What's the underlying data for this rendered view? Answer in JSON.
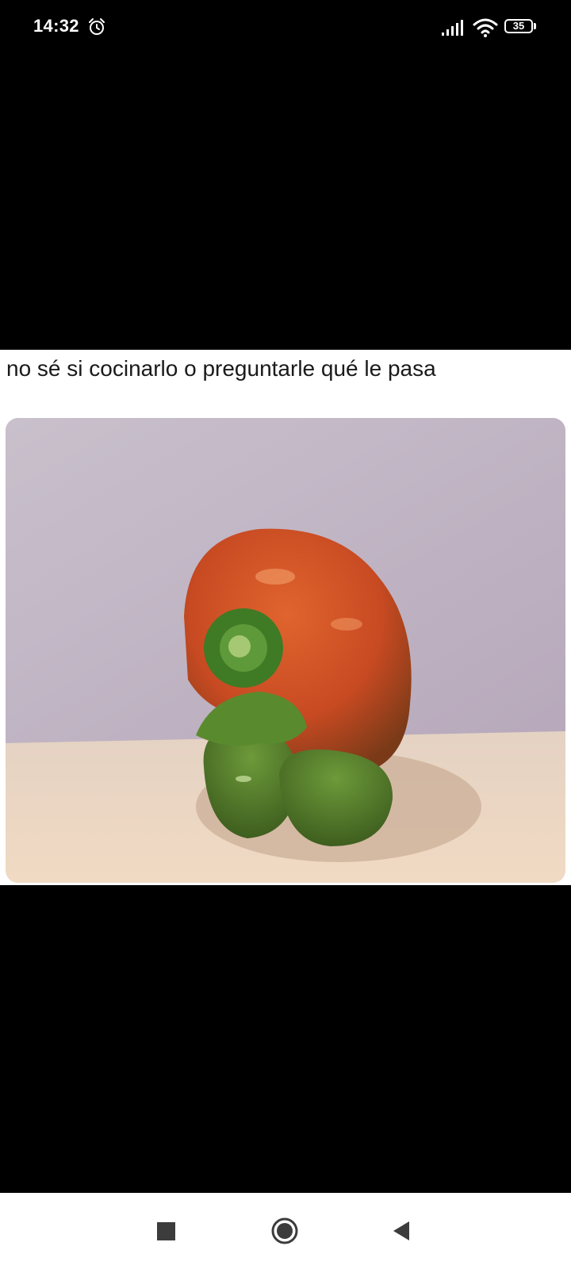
{
  "status_bar": {
    "time": "14:32",
    "alarm_icon": "alarm-clock-icon",
    "signal_icon": "cellular-signal-icon",
    "wifi_icon": "wifi-icon",
    "battery_level": "35"
  },
  "post": {
    "text": "no sé si cocinarlo o preguntarle qué le pasa",
    "image_icon": "photo-bell-pepper"
  },
  "nav_bar": {
    "recents_icon": "square-icon",
    "home_icon": "circle-icon",
    "back_icon": "triangle-back-icon"
  },
  "colors": {
    "background": "#000000",
    "card": "#ffffff",
    "text": "#1a1a1a"
  }
}
